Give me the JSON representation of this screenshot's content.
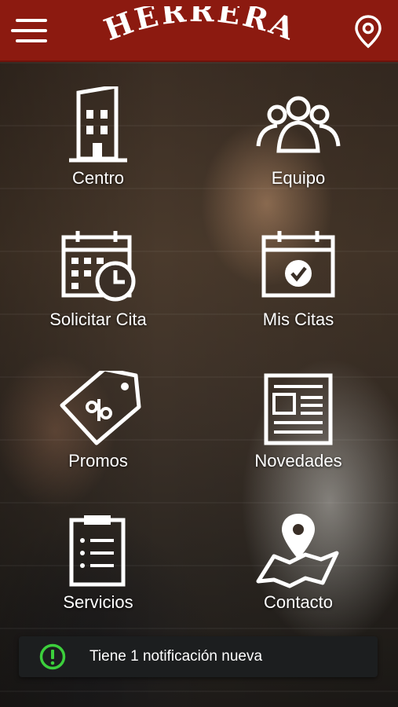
{
  "header": {
    "brand": "HERRERA",
    "menu_icon": "hamburger-menu-icon",
    "location_icon": "map-pin-icon",
    "background_color": "#8c1a10"
  },
  "tiles": [
    {
      "label": "Centro",
      "icon": "building-icon"
    },
    {
      "label": "Equipo",
      "icon": "team-icon"
    },
    {
      "label": "Solicitar Cita",
      "icon": "calendar-clock-icon"
    },
    {
      "label": "Mis Citas",
      "icon": "calendar-check-icon"
    },
    {
      "label": "Promos",
      "icon": "discount-tag-icon"
    },
    {
      "label": "Novedades",
      "icon": "newspaper-icon"
    },
    {
      "label": "Servicios",
      "icon": "clipboard-list-icon"
    },
    {
      "label": "Contacto",
      "icon": "map-location-icon"
    }
  ],
  "notification": {
    "text": "Tiene 1 notificación nueva",
    "icon": "alert-circle-icon",
    "icon_color": "#3ccf3c"
  }
}
